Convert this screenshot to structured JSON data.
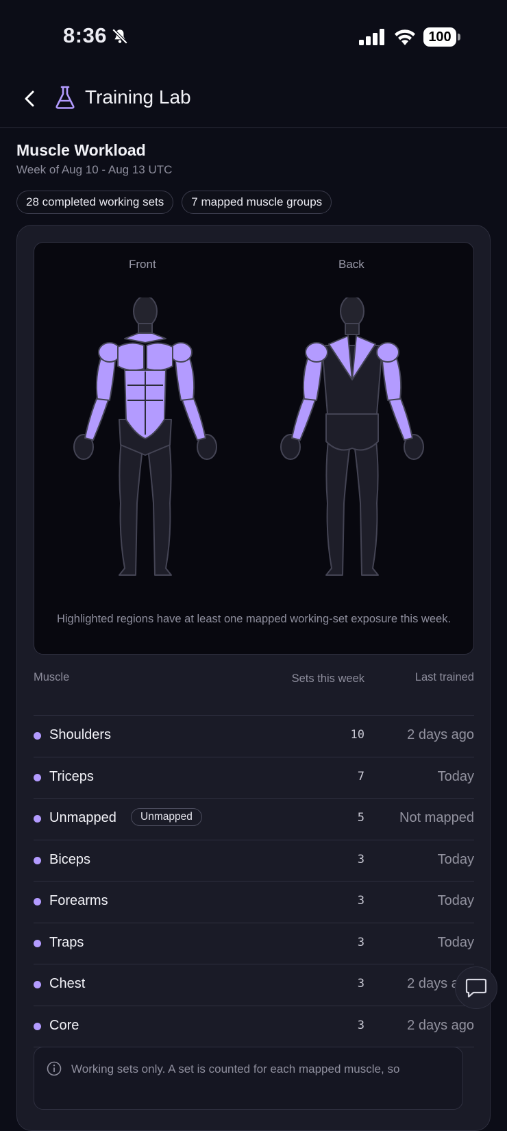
{
  "status": {
    "time": "8:36",
    "battery": "100",
    "icons": [
      "bell-slash-icon",
      "cellular-signal-icon",
      "wifi-icon",
      "battery-icon"
    ]
  },
  "header": {
    "title": "Training Lab",
    "back_icon": "chevron-left-icon",
    "app_icon": "flask-icon"
  },
  "section": {
    "title": "Muscle Workload",
    "subtitle": "Week of Aug 10 - Aug 13 UTC",
    "chips": [
      "28 completed working sets",
      "7 mapped muscle groups"
    ]
  },
  "body_map": {
    "front_label": "Front",
    "back_label": "Back",
    "caption": "Highlighted regions have at least one mapped working-set exposure this week.",
    "highlight_color": "#b39bff"
  },
  "table": {
    "headers": {
      "muscle": "Muscle",
      "sets": "Sets this week",
      "last": "Last trained"
    },
    "rows": [
      {
        "muscle": "Shoulders",
        "badge": "",
        "sets": "10",
        "last": "2 days ago"
      },
      {
        "muscle": "Triceps",
        "badge": "",
        "sets": "7",
        "last": "Today"
      },
      {
        "muscle": "Unmapped",
        "badge": "Unmapped",
        "sets": "5",
        "last": "Not mapped"
      },
      {
        "muscle": "Biceps",
        "badge": "",
        "sets": "3",
        "last": "Today"
      },
      {
        "muscle": "Forearms",
        "badge": "",
        "sets": "3",
        "last": "Today"
      },
      {
        "muscle": "Traps",
        "badge": "",
        "sets": "3",
        "last": "Today"
      },
      {
        "muscle": "Chest",
        "badge": "",
        "sets": "3",
        "last": "2 days ago"
      },
      {
        "muscle": "Core",
        "badge": "",
        "sets": "3",
        "last": "2 days ago"
      }
    ]
  },
  "note": {
    "icon": "info-icon",
    "text": "Working sets only. A set is counted for each mapped muscle, so"
  },
  "fab": {
    "icon": "chat-bubble-icon"
  }
}
